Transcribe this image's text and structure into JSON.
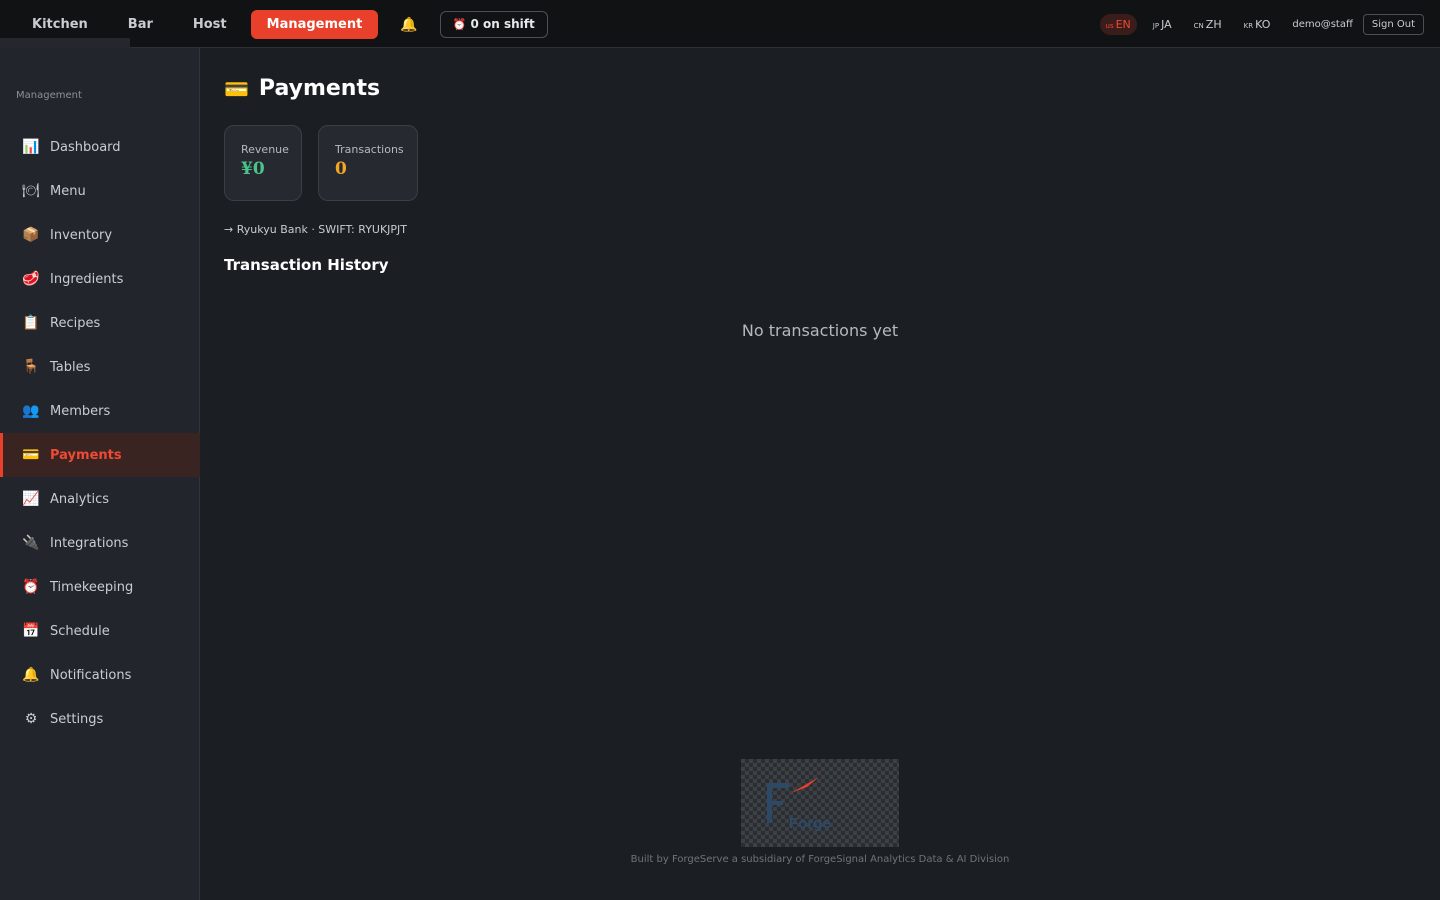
{
  "topnav": {
    "tabs": [
      {
        "label": "Kitchen"
      },
      {
        "label": "Bar"
      },
      {
        "label": "Host"
      },
      {
        "label": "Management",
        "active": true
      }
    ],
    "bell_icon": "bell-icon",
    "shift": {
      "icon": "alarm-clock-icon",
      "label": "0 on shift"
    }
  },
  "languages": [
    {
      "cc": "us",
      "label": "EN",
      "active": true
    },
    {
      "cc": "JP",
      "label": "JA"
    },
    {
      "cc": "CN",
      "label": "ZH"
    },
    {
      "cc": "KR",
      "label": "KO"
    }
  ],
  "user": "demo@staff",
  "sign_out": "Sign Out",
  "sidebar": {
    "title": "Management",
    "items": [
      {
        "icon": "bar-chart-icon",
        "label": "Dashboard"
      },
      {
        "icon": "plate-icon",
        "label": "Menu"
      },
      {
        "icon": "box-icon",
        "label": "Inventory"
      },
      {
        "icon": "meat-icon",
        "label": "Ingredients"
      },
      {
        "icon": "clipboard-icon",
        "label": "Recipes"
      },
      {
        "icon": "chair-icon",
        "label": "Tables"
      },
      {
        "icon": "people-icon",
        "label": "Members"
      },
      {
        "icon": "credit-card-icon",
        "label": "Payments",
        "active": true
      },
      {
        "icon": "line-chart-icon",
        "label": "Analytics"
      },
      {
        "icon": "plug-icon",
        "label": "Integrations"
      },
      {
        "icon": "alarm-clock-icon",
        "label": "Timekeeping"
      },
      {
        "icon": "calendar-icon",
        "label": "Schedule"
      },
      {
        "icon": "bell-icon",
        "label": "Notifications"
      },
      {
        "icon": "gear-icon",
        "label": "Settings"
      }
    ]
  },
  "main": {
    "title": "Payments",
    "title_icon": "credit-card-icon",
    "stats": [
      {
        "label": "Revenue",
        "value": "¥0",
        "color": "#4cc38a"
      },
      {
        "label": "Transactions",
        "value": "0",
        "color": "#f5a623"
      }
    ],
    "bank_line": "→ Ryukyu Bank · SWIFT: RYUKJPJT",
    "history_title": "Transaction History",
    "empty_text": "No transactions yet"
  },
  "footer": {
    "text": "Built by ForgeServe a subsidiary of ForgeSignal Analytics Data & AI Division",
    "logo_text": "Forge"
  },
  "colors": {
    "accent": "#e8402a",
    "background": "#1b1f24",
    "sidebar": "#22262c"
  }
}
